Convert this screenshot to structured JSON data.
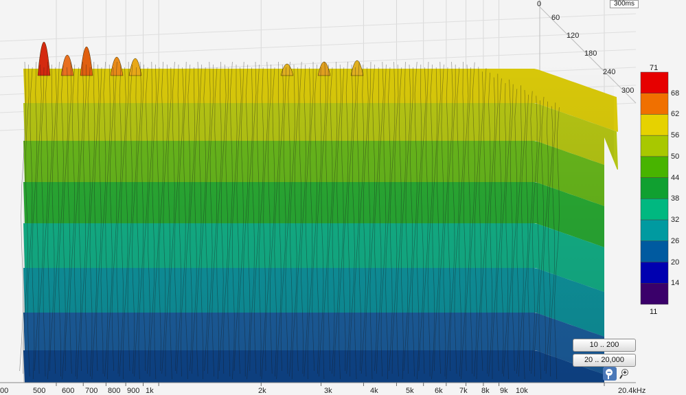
{
  "chart_data": {
    "type": "waterfall",
    "x_axis": {
      "scale": "log",
      "unit": "Hz",
      "tick_labels": [
        "500",
        "600",
        "700",
        "800",
        "900",
        "1k",
        "2k",
        "3k",
        "4k",
        "5k",
        "6k",
        "7k",
        "8k",
        "9k",
        "10k",
        "20.4kHz"
      ],
      "tick_values": [
        500,
        600,
        700,
        800,
        900,
        1000,
        2000,
        3000,
        4000,
        5000,
        6000,
        7000,
        8000,
        9000,
        10000,
        20400
      ],
      "range": [
        400,
        20400
      ],
      "partial_left_label": "00"
    },
    "time_axis": {
      "unit": "ms",
      "tick_labels": [
        "0",
        "60",
        "120",
        "180",
        "240",
        "300"
      ],
      "end_label": "300ms"
    },
    "colorbar": {
      "min_label": "11",
      "max_label": "71",
      "band_labels": [
        "68",
        "62",
        "56",
        "50",
        "44",
        "38",
        "32",
        "26",
        "20",
        "14"
      ],
      "colors": [
        "#e60000",
        "#f07000",
        "#e6d200",
        "#a8c800",
        "#48b400",
        "#10a030",
        "#00b880",
        "#009aa0",
        "#005aa0",
        "#0000b0",
        "#3a006a"
      ]
    },
    "buttons": [
      "10 .. 200",
      "20 .. 20,000"
    ],
    "icons": [
      "zoom-out-icon",
      "zoom-in-icon"
    ]
  }
}
